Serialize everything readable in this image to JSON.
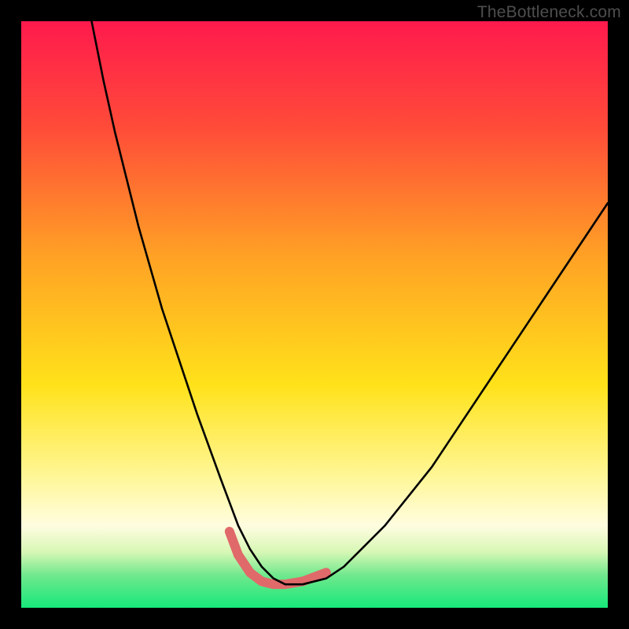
{
  "watermark": "TheBottleneck.com",
  "chart_data": {
    "type": "line",
    "title": "",
    "xlabel": "",
    "ylabel": "",
    "xlim": [
      0,
      100
    ],
    "ylim": [
      0,
      100
    ],
    "notes": "Axes are not labeled in the image; x/y units are normalized 0–100 from the plot extents. Background is a vertical gradient (red→orange→yellow→cream→green) with a thin black curve dipping to a flat bottom and a short pink bracket marking the trough.",
    "gradient_stops": [
      {
        "offset": 0.0,
        "color": "#ff1a4d"
      },
      {
        "offset": 0.18,
        "color": "#ff4b39"
      },
      {
        "offset": 0.4,
        "color": "#ffa125"
      },
      {
        "offset": 0.62,
        "color": "#ffe21a"
      },
      {
        "offset": 0.78,
        "color": "#fff79a"
      },
      {
        "offset": 0.86,
        "color": "#fffde0"
      },
      {
        "offset": 0.905,
        "color": "#d7f7b5"
      },
      {
        "offset": 0.945,
        "color": "#6fe88d"
      },
      {
        "offset": 1.0,
        "color": "#17e87a"
      }
    ],
    "series": [
      {
        "name": "curve",
        "color": "#000000",
        "x": [
          12,
          14,
          16,
          18,
          20,
          22,
          24,
          26,
          28,
          30,
          32,
          34,
          35.5,
          37,
          39,
          41,
          43,
          45,
          48,
          52,
          55,
          58,
          62,
          66,
          70,
          74,
          78,
          82,
          86,
          90,
          94,
          98,
          100
        ],
        "y": [
          100,
          90,
          81,
          73,
          65,
          58,
          51,
          45,
          39,
          33,
          27.5,
          22,
          18,
          14,
          10,
          7,
          5,
          4,
          4,
          5,
          7,
          10,
          14,
          19,
          24,
          30,
          36,
          42,
          48,
          54,
          60,
          66,
          69
        ]
      }
    ],
    "marker": {
      "name": "trough-bracket",
      "color": "#e06a6a",
      "x": [
        35.5,
        37,
        39,
        41,
        43,
        45,
        48,
        52
      ],
      "y": [
        13,
        9,
        6,
        4.5,
        4,
        4,
        4.5,
        6
      ]
    }
  }
}
